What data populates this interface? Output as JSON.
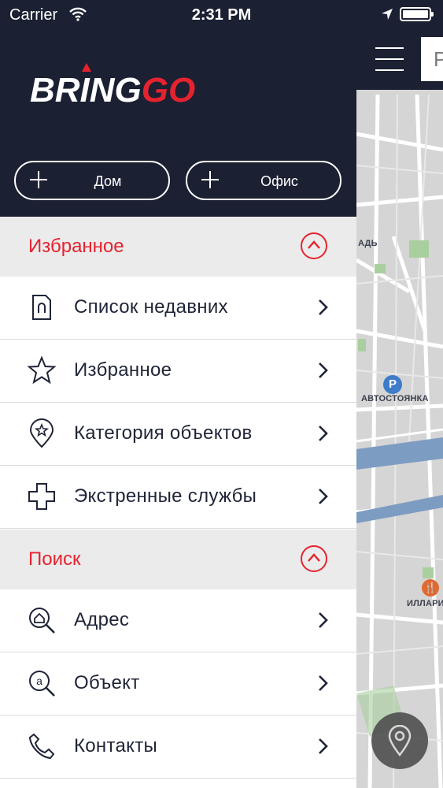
{
  "status_bar": {
    "carrier": "Carrier",
    "time": "2:31 PM"
  },
  "brand": {
    "logo_primary": "BRING",
    "logo_accent": "GO",
    "accent_color": "#e5232f",
    "header_color": "#1c2033"
  },
  "quick_places": [
    {
      "label": "Дом",
      "icon": "plus-icon"
    },
    {
      "label": "Офис",
      "icon": "plus-icon"
    }
  ],
  "sections": [
    {
      "title": "Избранное",
      "items": [
        {
          "label": "Список недавних",
          "icon": "recent-list-icon"
        },
        {
          "label": "Избранное",
          "icon": "star-icon"
        },
        {
          "label": "Категория объектов",
          "icon": "category-pin-icon"
        },
        {
          "label": "Экстренные службы",
          "icon": "emergency-cross-icon"
        }
      ]
    },
    {
      "title": "Поиск",
      "items": [
        {
          "label": "Адрес",
          "icon": "address-search-icon"
        },
        {
          "label": "Объект",
          "icon": "object-search-icon"
        },
        {
          "label": "Контакты",
          "icon": "phone-icon"
        }
      ]
    }
  ],
  "map": {
    "search_text": "P",
    "labels": [
      "АДЬ",
      "АВТОСТОЯНКА",
      "ИЛЛАРИ"
    ],
    "parking_badge": "P"
  }
}
